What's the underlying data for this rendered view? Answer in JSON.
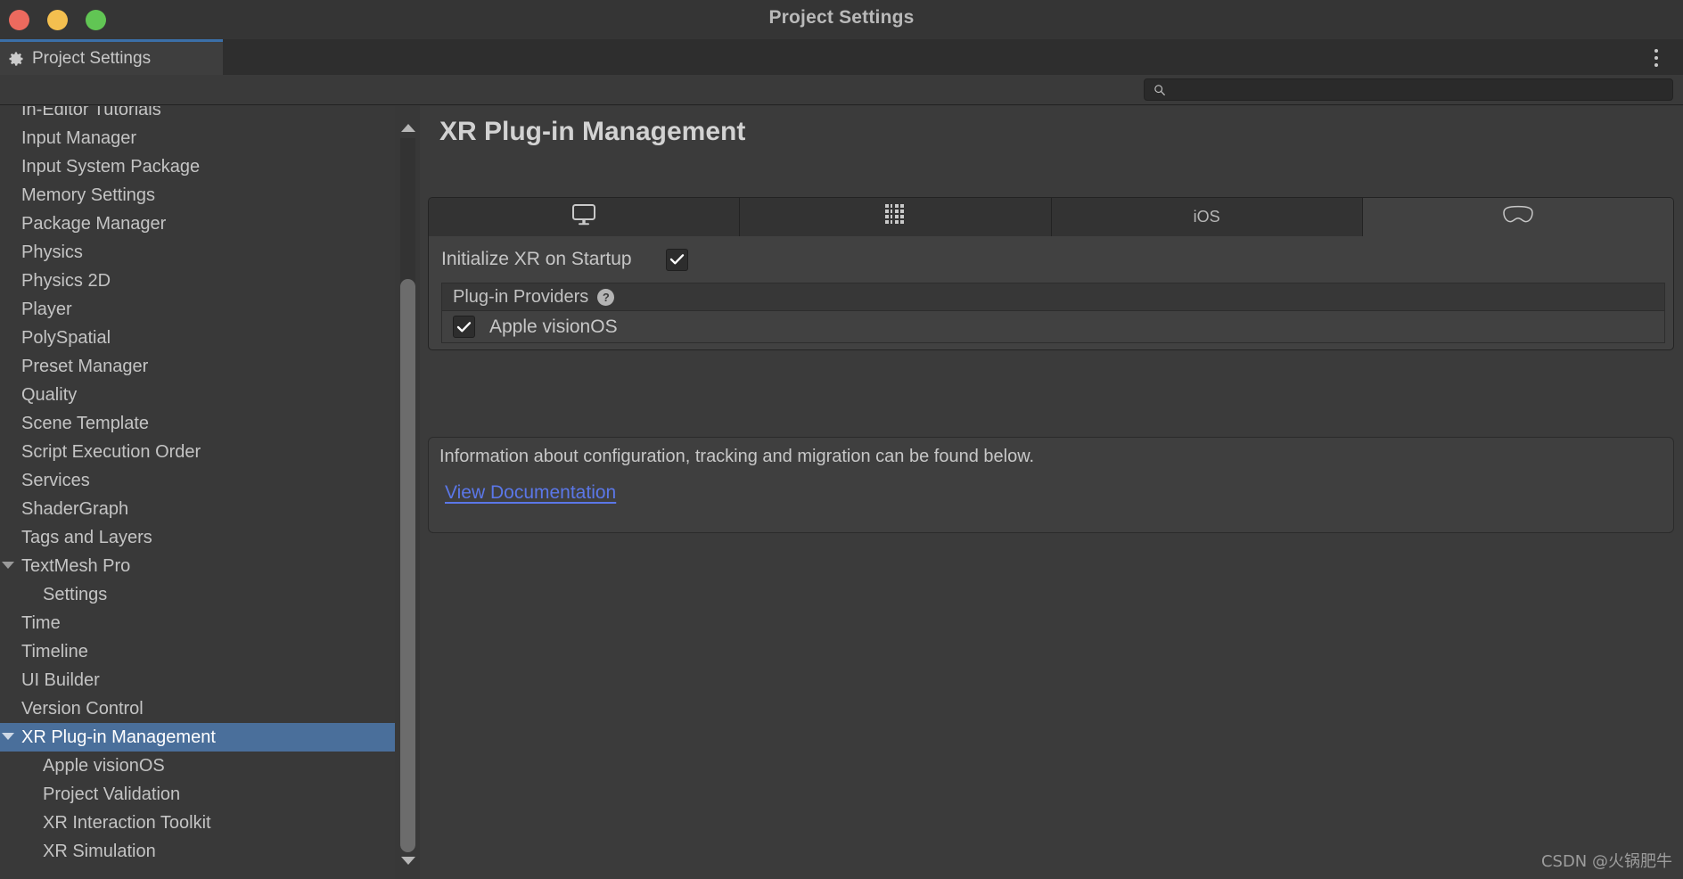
{
  "window": {
    "title": "Project Settings",
    "traffic_lights": [
      "close",
      "minimize",
      "zoom"
    ]
  },
  "tabstrip": {
    "tab_label": "Project Settings",
    "tab_icon": "gear-icon",
    "overflow_menu_icon": "kebab-menu-icon"
  },
  "search": {
    "value": "",
    "placeholder": "",
    "icon": "search-icon"
  },
  "sidebar": {
    "items": [
      {
        "label": "In-Editor Tutorials",
        "indent": 0,
        "twisty": false,
        "selected": false
      },
      {
        "label": "Input Manager",
        "indent": 0,
        "twisty": false,
        "selected": false
      },
      {
        "label": "Input System Package",
        "indent": 0,
        "twisty": false,
        "selected": false
      },
      {
        "label": "Memory Settings",
        "indent": 0,
        "twisty": false,
        "selected": false
      },
      {
        "label": "Package Manager",
        "indent": 0,
        "twisty": false,
        "selected": false
      },
      {
        "label": "Physics",
        "indent": 0,
        "twisty": false,
        "selected": false
      },
      {
        "label": "Physics 2D",
        "indent": 0,
        "twisty": false,
        "selected": false
      },
      {
        "label": "Player",
        "indent": 0,
        "twisty": false,
        "selected": false
      },
      {
        "label": "PolySpatial",
        "indent": 0,
        "twisty": false,
        "selected": false
      },
      {
        "label": "Preset Manager",
        "indent": 0,
        "twisty": false,
        "selected": false
      },
      {
        "label": "Quality",
        "indent": 0,
        "twisty": false,
        "selected": false
      },
      {
        "label": "Scene Template",
        "indent": 0,
        "twisty": false,
        "selected": false
      },
      {
        "label": "Script Execution Order",
        "indent": 0,
        "twisty": false,
        "selected": false
      },
      {
        "label": "Services",
        "indent": 0,
        "twisty": false,
        "selected": false
      },
      {
        "label": "ShaderGraph",
        "indent": 0,
        "twisty": false,
        "selected": false
      },
      {
        "label": "Tags and Layers",
        "indent": 0,
        "twisty": false,
        "selected": false
      },
      {
        "label": "TextMesh Pro",
        "indent": 0,
        "twisty": true,
        "selected": false
      },
      {
        "label": "Settings",
        "indent": 1,
        "twisty": false,
        "selected": false
      },
      {
        "label": "Time",
        "indent": 0,
        "twisty": false,
        "selected": false
      },
      {
        "label": "Timeline",
        "indent": 0,
        "twisty": false,
        "selected": false
      },
      {
        "label": "UI Builder",
        "indent": 0,
        "twisty": false,
        "selected": false
      },
      {
        "label": "Version Control",
        "indent": 0,
        "twisty": false,
        "selected": false
      },
      {
        "label": "XR Plug-in Management",
        "indent": 0,
        "twisty": true,
        "selected": true
      },
      {
        "label": "Apple visionOS",
        "indent": 1,
        "twisty": false,
        "selected": false
      },
      {
        "label": "Project Validation",
        "indent": 1,
        "twisty": false,
        "selected": false
      },
      {
        "label": "XR Interaction Toolkit",
        "indent": 1,
        "twisty": false,
        "selected": false
      },
      {
        "label": "XR Simulation",
        "indent": 1,
        "twisty": false,
        "selected": false
      }
    ],
    "scrollbar": {
      "up_arrow_icon": "scroll-up-arrow-icon",
      "down_arrow_icon": "scroll-down-arrow-icon"
    },
    "selection_color": "#4a6f9b"
  },
  "main": {
    "title": "XR Plug-in Management",
    "platform_tabs": [
      {
        "label": "",
        "icon": "desktop-monitor-icon",
        "active": false
      },
      {
        "label": "",
        "icon": "dedicated-server-icon",
        "active": false
      },
      {
        "label": "iOS",
        "icon": "",
        "active": false
      },
      {
        "label": "",
        "icon": "visionos-headset-icon",
        "active": true
      }
    ],
    "initialize_xr": {
      "label": "Initialize XR on Startup",
      "checked": true
    },
    "providers": {
      "header": "Plug-in Providers",
      "help_icon": "help-question-icon",
      "help_glyph": "?",
      "list": [
        {
          "label": "Apple visionOS",
          "checked": true
        }
      ]
    },
    "info": {
      "text": "Information about configuration, tracking and migration can be found below.",
      "link_label": "View Documentation",
      "link_color": "#5b77e8"
    }
  },
  "watermark": {
    "text": "CSDN @火锅肥牛"
  }
}
